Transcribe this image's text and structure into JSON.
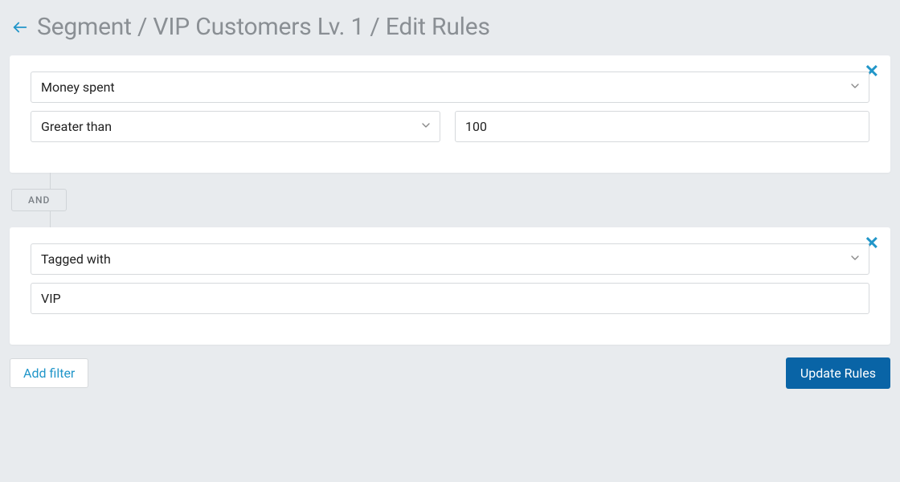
{
  "header": {
    "breadcrumb": "Segment / VIP Customers Lv. 1 / Edit Rules"
  },
  "connector": "AND",
  "filters": [
    {
      "field": "Money spent",
      "operator": "Greater than",
      "value": "100"
    },
    {
      "field": "Tagged with",
      "value": "VIP"
    }
  ],
  "actions": {
    "add_filter": "Add filter",
    "update_rules": "Update Rules"
  },
  "icons": {
    "close": "✕"
  }
}
